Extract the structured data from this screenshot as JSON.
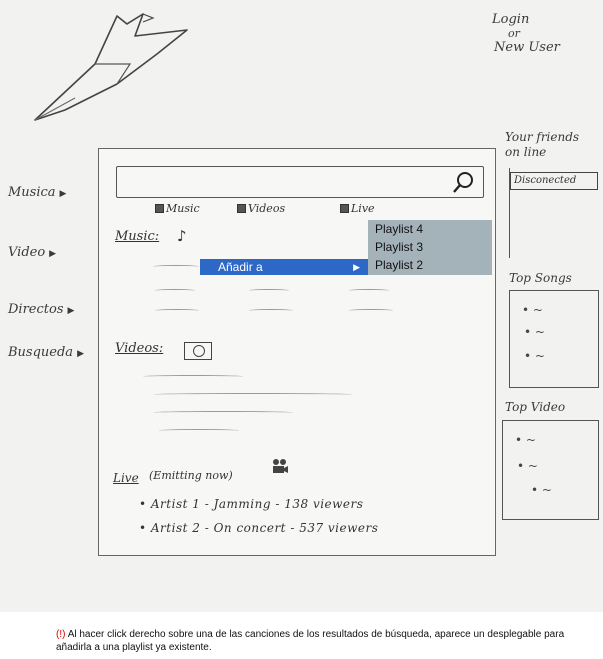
{
  "header": {
    "login": "Login",
    "or": "or",
    "new_user": "New User"
  },
  "nav": {
    "items": [
      {
        "label": "Musica"
      },
      {
        "label": "Video"
      },
      {
        "label": "Directos"
      },
      {
        "label": "Busqueda"
      }
    ],
    "arrow": "▶"
  },
  "search": {
    "value": "",
    "icon": "search-icon"
  },
  "filters": [
    {
      "label": "Music",
      "checked": true
    },
    {
      "label": "Videos",
      "checked": true
    },
    {
      "label": "Live",
      "checked": true
    }
  ],
  "music": {
    "title": "Music:",
    "note_icon": "♪"
  },
  "videos": {
    "title": "Videos:"
  },
  "live": {
    "title": "Live",
    "note": "(Emitting now)",
    "rows": [
      {
        "text": "• Artist 1 - Jamming - 138 viewers"
      },
      {
        "text": "• Artist 2 - On concert - 537 viewers"
      }
    ]
  },
  "context_menu": {
    "label": "Añadir a",
    "arrow": "▶",
    "submenu": [
      "Playlist 4",
      "Playlist 3",
      "Playlist 2"
    ]
  },
  "right": {
    "friends_title_1": "Your friends",
    "friends_title_2": "on line",
    "friends_status": "Disconected",
    "top_songs": "Top Songs",
    "top_video": "Top Video",
    "bullet": "• ~"
  },
  "caption": {
    "flag": "(!)",
    "text": "Al hacer click derecho sobre una de las canciones de los resultados de búsqueda, aparece un desplegable para añadirla a una playlist ya existente."
  },
  "colors": {
    "menu_highlight": "#2d68c6",
    "submenu_bg": "#a4b2ba",
    "caption_flag": "#d40000"
  }
}
